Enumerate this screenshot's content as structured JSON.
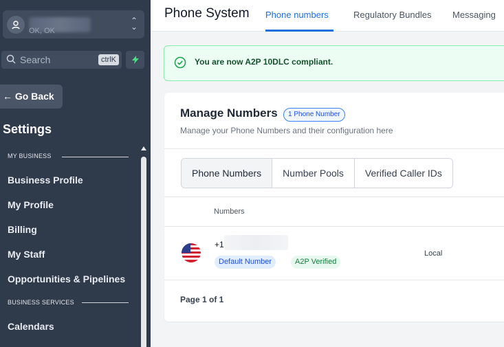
{
  "sidebar": {
    "account_location": "OK, OK",
    "search_placeholder": "Search",
    "search_shortcut": "ctrlK",
    "go_back": "← Go Back",
    "title": "Settings",
    "sections": [
      {
        "heading": "MY BUSINESS",
        "items": [
          "Business Profile",
          "My Profile",
          "Billing",
          "My Staff",
          "Opportunities & Pipelines"
        ]
      },
      {
        "heading": "BUSINESS SERVICES",
        "items": [
          "Calendars"
        ]
      }
    ]
  },
  "header": {
    "title": "Phone System",
    "tabs": [
      {
        "label": "Phone numbers",
        "active": true
      },
      {
        "label": "Regulatory Bundles",
        "active": false
      },
      {
        "label": "Messaging",
        "active": false
      }
    ]
  },
  "banner": {
    "message": "You are now A2P 10DLC compliant."
  },
  "manage": {
    "title": "Manage Numbers",
    "count_badge": "1 Phone Number",
    "subtitle": "Manage your Phone Numbers and their configuration here",
    "segments": [
      "Phone Numbers",
      "Number Pools",
      "Verified Caller IDs"
    ],
    "column_header": "Numbers",
    "rows": [
      {
        "number_prefix": "+1",
        "badges": [
          "Default Number",
          "A2P Verified"
        ],
        "type": "Local"
      }
    ],
    "pagination": "Page 1 of 1"
  },
  "colors": {
    "sidebar_bg": "#2f3a4b",
    "accent": "#1d6fdc",
    "success_bg": "#ecfdf3"
  }
}
